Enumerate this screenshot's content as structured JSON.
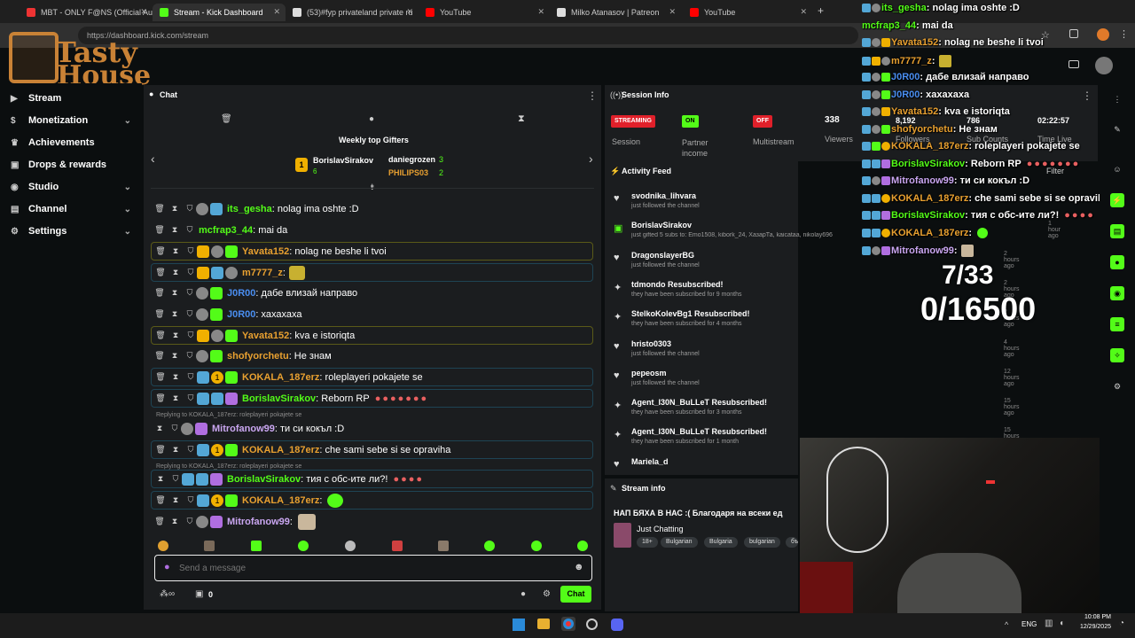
{
  "browser": {
    "tabs": [
      {
        "label": "MBT - ONLY F@NS (Official Au",
        "color": "#e33"
      },
      {
        "label": "Stream - Kick Dashboard",
        "color": "#53fc18"
      },
      {
        "label": "(53)#fyp privateland private ru",
        "color": "#ddd"
      },
      {
        "label": "YouTube",
        "color": "#f00"
      },
      {
        "label": "Milko Atanasov | Patreon",
        "color": "#ddd"
      },
      {
        "label": "YouTube",
        "color": "#f00"
      }
    ],
    "url": "https://dashboard.kick.com/stream"
  },
  "logo": {
    "line1": "Tasty",
    "line2": "House"
  },
  "nav": {
    "items": [
      {
        "label": "Stream",
        "icon": "video-icon"
      },
      {
        "label": "Monetization",
        "icon": "dollar-icon"
      },
      {
        "label": "Achievements",
        "icon": "trophy-icon"
      },
      {
        "label": "Drops & rewards",
        "icon": "gift-icon"
      },
      {
        "label": "Studio",
        "icon": "studio-icon"
      },
      {
        "label": "Channel",
        "icon": "channel-icon"
      },
      {
        "label": "Settings",
        "icon": "gear-icon"
      }
    ]
  },
  "chat": {
    "title": "Chat",
    "top_gifters_title": "Weekly top Gifters",
    "gifters": [
      {
        "name": "BorislavSirakov",
        "count": "6"
      },
      {
        "name": "daniegrozen",
        "count": "3"
      },
      {
        "name": "PHILIPS03",
        "count": "2"
      }
    ],
    "messages": [
      {
        "user": "its_gesha",
        "text": ": nolag ima oshte :D",
        "color": "#53fc18"
      },
      {
        "user": "mcfrap3_44",
        "text": ": mai da",
        "color": "#53fc18"
      },
      {
        "user": "Yavata152",
        "text": ": nolag ne beshe li tvoi",
        "color": "#e8a030"
      },
      {
        "user": "m7777_z",
        "text": ":",
        "color": "#e8a030"
      },
      {
        "user": "J0R00",
        "text": ": дабе влизай направо",
        "color": "#4a8ef0"
      },
      {
        "user": "J0R00",
        "text": ": хахахаха",
        "color": "#4a8ef0"
      },
      {
        "user": "Yavata152",
        "text": ": kva e istoriqta",
        "color": "#e8a030"
      },
      {
        "user": "shofyorchetu",
        "text": ": Не знам",
        "color": "#e8a030"
      },
      {
        "user": "KOKALA_187erz",
        "text": ": roleplayeri pokajete se",
        "color": "#e8a030"
      },
      {
        "user": "BorislavSirakov",
        "text": ": Reborn RP",
        "color": "#53fc18"
      },
      {
        "user": "Mitrofanow99",
        "text": ": ти си кокъл :D",
        "color": "#c9a6f0"
      },
      {
        "user": "KOKALA_187erz",
        "text": ": che sami sebe si se opraviha",
        "color": "#e8a030"
      },
      {
        "user": "BorislavSirakov",
        "text": ": тия с обс-ите ли?!",
        "color": "#53fc18"
      },
      {
        "user": "KOKALA_187erz",
        "text": ":",
        "color": "#e8a030"
      },
      {
        "user": "Mitrofanow99",
        "text": ":",
        "color": "#c9a6f0"
      }
    ],
    "reply1": "Replying to KOKALA_187erz: roleplayeri pokajete se",
    "reply2": "Replying to KOKALA_187erz: roleplayeri pokajete se",
    "input_placeholder": "Send a message",
    "footer_count": "0",
    "send_label": "Chat"
  },
  "session": {
    "title": "Session Info",
    "streaming": "STREAMING",
    "on": "ON",
    "off": "OFF",
    "session_label": "Session",
    "partner_label": "Partner income",
    "multistream_label": "Multistream",
    "viewers": "338",
    "viewers_label": "Viewers",
    "followers": "8,192",
    "followers_label": "Followers",
    "subs": "786",
    "subs_label": "Sub Counts",
    "time": "02:22:57",
    "time_label": "Time Live"
  },
  "activity": {
    "title": "Activity Feed",
    "filter": "Filter",
    "items": [
      {
        "title": "svodnika_lihvara",
        "sub": "just followed the channel",
        "time": ""
      },
      {
        "title": "BorislavSirakov",
        "sub": "just gifted 5 subs to: Emo1508, kibork_24, ХазарТа, kaicataa, nikolay696",
        "time": "1 hour ago"
      },
      {
        "title": "DragonslayerBG",
        "sub": "just followed the channel",
        "time": "2 hours ago"
      },
      {
        "title": "tdmondo Resubscribed!",
        "sub": "they have been subscribed for 9 months",
        "time": "2 hours ago"
      },
      {
        "title": "StelkoKolevBg1 Resubscribed!",
        "sub": "they have been subscribed for 4 months",
        "time": "2 hours ago"
      },
      {
        "title": "hristo0303",
        "sub": "just followed the channel",
        "time": "4 hours ago"
      },
      {
        "title": "pepeosm",
        "sub": "just followed the channel",
        "time": "12 hours ago"
      },
      {
        "title": "Agent_I30N_BuLLeT Resubscribed!",
        "sub": "they have been subscribed for 3 months",
        "time": "15 hours ago"
      },
      {
        "title": "Agent_I30N_BuLLeT Resubscribed!",
        "sub": "they have been subscribed for 1 month",
        "time": "15 hours ago"
      },
      {
        "title": "Mariela_d",
        "sub": "",
        "time": ""
      }
    ]
  },
  "stream_info": {
    "title": "Stream info",
    "stream_title": "НАП БЯХА В НАС :(  Благодаря на всеки ед",
    "category": "Just Chatting",
    "tags": [
      "18+",
      "Bulgarian",
      "Bulgaria",
      "bulgarian",
      "бъ"
    ]
  },
  "overlay": {
    "lines": [
      {
        "user": "its_gesha",
        "text": ": nolag ima oshte :D"
      },
      {
        "user": "mcfrap3_44",
        "text": ": mai da"
      },
      {
        "user": "Yavata152",
        "text": ": nolag ne beshe li tvoi"
      },
      {
        "user": "m7777_z",
        "text": ":"
      },
      {
        "user": "J0R00",
        "text": ": дабе влизай направо"
      },
      {
        "user": "J0R00",
        "text": ": хахахаха"
      },
      {
        "user": "Yavata152",
        "text": ": kva e istoriqta"
      },
      {
        "user": "shofyorchetu",
        "text": ": Не знам"
      },
      {
        "user": "KOKALA_187erz",
        "text": ": roleplayeri pokajete se"
      },
      {
        "user": "BorislavSirakov",
        "text": ": Reborn RP"
      },
      {
        "user": "Mitrofanow99",
        "text": ": ти си кокъл :D"
      },
      {
        "user": "KOKALA_187erz",
        "text": ": che sami sebe si se opraviha"
      },
      {
        "user": "BorislavSirakov",
        "text": ": тия с обс-ите ли?!"
      },
      {
        "user": "KOKALA_187erz",
        "text": ":"
      },
      {
        "user": "Mitrofanow99",
        "text": ":"
      }
    ],
    "goal1": "7/33",
    "goal2": "0/16500"
  },
  "taskbar": {
    "lang": "ENG",
    "time": "10:08 PM",
    "date": "12/29/2025"
  }
}
